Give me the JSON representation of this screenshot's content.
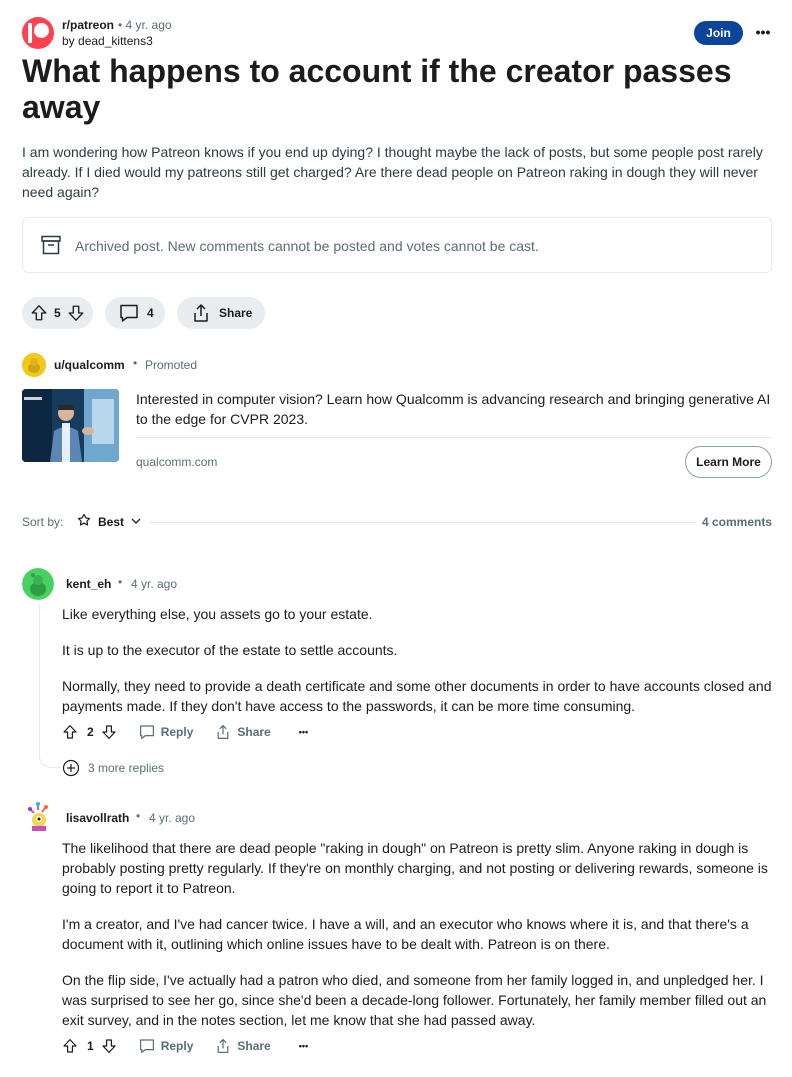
{
  "post": {
    "subreddit": "r/patreon",
    "age": "• 4 yr. ago",
    "author_prefix": "by",
    "author": "dead_kittens3",
    "join_label": "Join",
    "more_label": "•••",
    "title": "What happens to account if the creator passes away",
    "body": "I am wondering how Patreon knows if you end up dying? I thought maybe the lack of posts, but some people post rarely already. If I died would my patreons still get charged? Are there dead people on Patreon raking in dough they will never need again?",
    "archived_notice": "Archived post. New comments cannot be posted and votes cannot be cast.",
    "score": "5",
    "comment_count": "4",
    "share_label": "Share"
  },
  "promoted": {
    "user": "u/qualcomm",
    "dot": "•",
    "label": "Promoted",
    "text": "Interested in computer vision? Learn how Qualcomm is advancing research and bringing generative AI to the edge for CVPR 2023.",
    "domain": "qualcomm.com",
    "cta": "Learn More"
  },
  "sort": {
    "label": "Sort by:",
    "value": "Best",
    "count_label": "4 comments"
  },
  "comments": [
    {
      "user": "kent_eh",
      "age": "4 yr. ago",
      "paragraphs": [
        "Like everything else, you assets go to your estate.",
        "It is up to the executor of the estate to settle accounts.",
        "Normally, they need to provide a death certificate and some other documents in order to have accounts closed and payments made. If they don't have access to the passwords, it can be more time consuming."
      ],
      "score": "2",
      "reply_label": "Reply",
      "share_label": "Share",
      "more_label": "•••",
      "more_replies": "3 more replies"
    },
    {
      "user": "lisavollrath",
      "age": "4 yr. ago",
      "paragraphs": [
        "The likelihood that there are dead people \"raking in dough\" on Patreon is pretty slim. Anyone raking in dough is probably posting pretty regularly. If they're on monthly charging, and not posting or delivering rewards, someone is going to report it to Patreon.",
        "I'm a creator, and I've had cancer twice. I have a will, and an executor who knows where it is, and that there's a document with it, outlining which online issues have to be dealt with. Patreon is on there.",
        "On the flip side, I've actually had a patron who died, and someone from her family logged in, and unpledged her. I was surprised to see her go, since she'd been a decade-long follower. Fortunately, her family member filled out an exit survey, and in the notes section, let me know that she had passed away."
      ],
      "score": "1",
      "reply_label": "Reply",
      "share_label": "Share",
      "more_label": "•••"
    }
  ],
  "colors": {
    "join_bg": "#0a449b",
    "patreon_red": "#ff424d",
    "muted": "#576f76",
    "pill_bg": "#eaedef"
  },
  "icons": [
    "archive-icon",
    "upvote-icon",
    "downvote-icon",
    "comment-icon",
    "share-icon",
    "sort-icon",
    "chevron-down-icon",
    "add-circle-icon"
  ]
}
